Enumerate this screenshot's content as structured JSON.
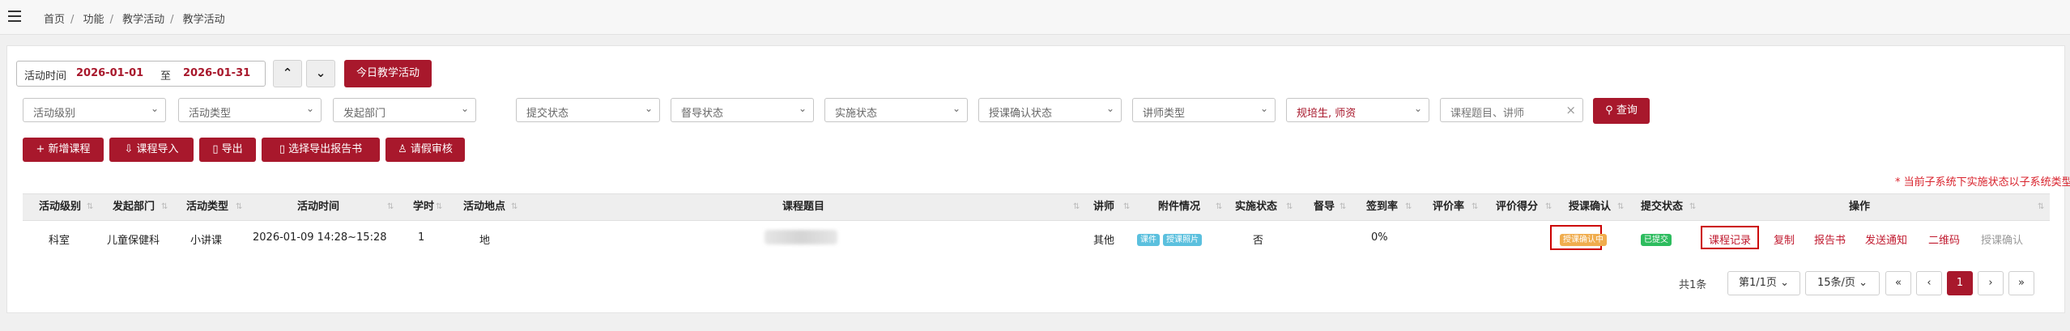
{
  "breadcrumb": [
    "首页",
    "功能",
    "教学活动",
    "教学活动"
  ],
  "date_filter": {
    "label": "活动时间",
    "start": "2026-01-01",
    "to": "至",
    "end": "2026-01-31"
  },
  "today_button": "今日教学活动",
  "filters": [
    "活动级别",
    "活动类型",
    "发起部门",
    "提交状态",
    "督导状态",
    "实施状态",
    "授课确认状态",
    "讲师类型"
  ],
  "trainee_filter": "规培生, 师资",
  "search": {
    "placeholder": "课程题目、讲师",
    "clear": "×",
    "button": "查询"
  },
  "actions": {
    "add": "新增课程",
    "import": "课程导入",
    "export": "导出",
    "export_report": "选择导出报告书",
    "leave_review": "请假审核"
  },
  "note": "* 当前子系统下实施状态以子系统类型为主",
  "table": {
    "headers": [
      "活动级别",
      "发起部门",
      "活动类型",
      "活动时间",
      "学时",
      "活动地点",
      "课程题目",
      "讲师",
      "附件情况",
      "实施状态",
      "督导",
      "签到率",
      "评价率",
      "评价得分",
      "授课确认",
      "提交状态",
      "操作"
    ],
    "row": {
      "level": "科室",
      "dept": "儿童保健科",
      "type": "小讲课",
      "time": "2026-01-09 14:28~15:28",
      "hours": "1",
      "place": "地",
      "lecturer": "其他",
      "attachments": [
        "课件",
        "授课照片"
      ],
      "status": "否",
      "sign_rate": "0%",
      "confirm": "授课确认中",
      "submit": "已提交",
      "ops": [
        "课程记录",
        "复制",
        "报告书",
        "发送通知",
        "二维码",
        "授课确认"
      ]
    }
  },
  "pagination": {
    "total": "共1条",
    "page_select": "第1/1页",
    "size_select": "15条/页",
    "first": "«",
    "prev": "‹",
    "current": "1",
    "next": "›",
    "last": "»"
  },
  "colors": {
    "primary": "#a8182c",
    "link": "#c0192e",
    "note": "#d9232d"
  }
}
